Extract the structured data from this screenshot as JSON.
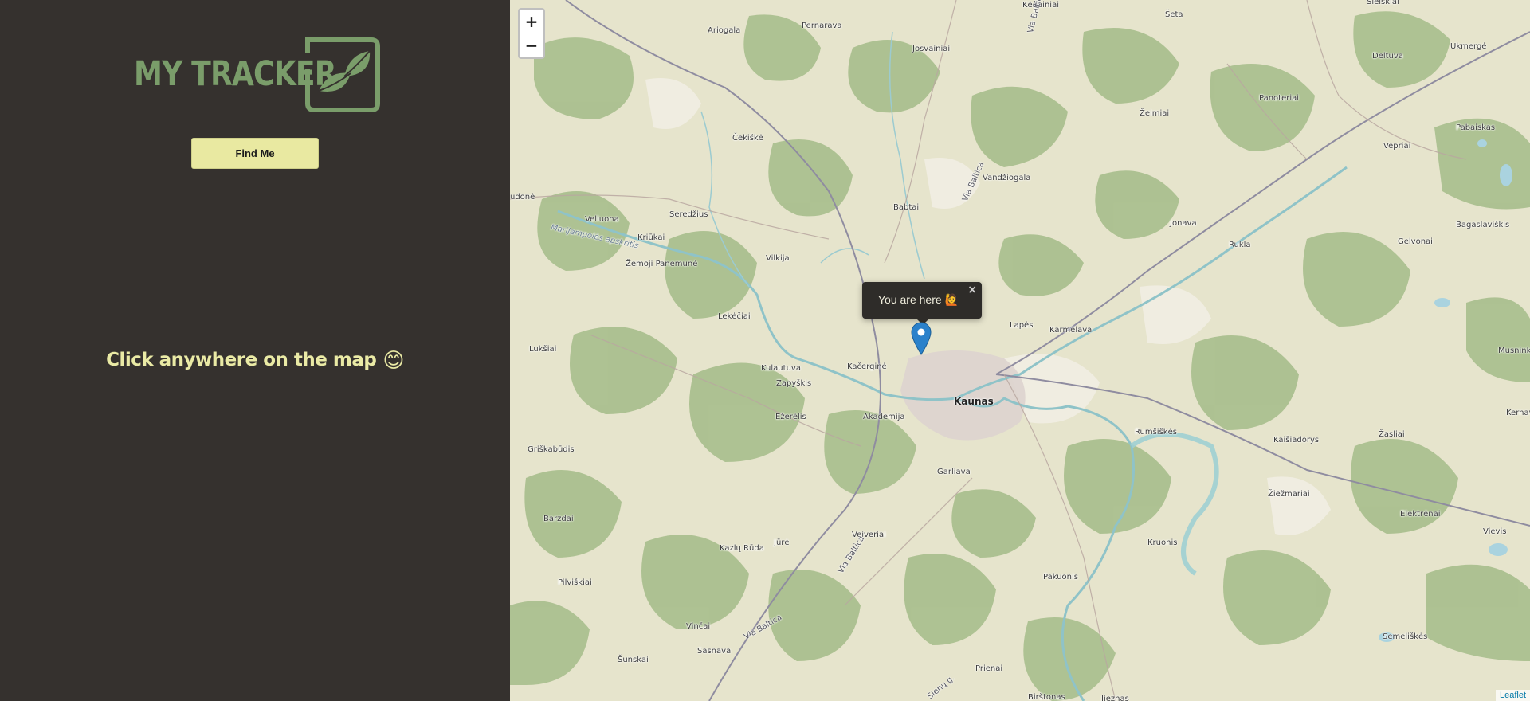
{
  "sidebar": {
    "logo_text": "MY TRACKER",
    "find_button_label": "Find Me",
    "hint_text": "Click anywhere on the map",
    "hint_emoji": "😊"
  },
  "map": {
    "zoom_in": "+",
    "zoom_out": "−",
    "popup_text": "You are here 🙋",
    "popup_close": "×",
    "attribution": "Leaflet",
    "labels": {
      "kedainiai": "Kėdainiai",
      "seta": "Šeta",
      "sleksne": "Sleiškiai",
      "ariogala": "Ariogala",
      "pernarava": "Pernarava",
      "josvainiai": "Josvainiai",
      "ukmerge": "Ukmergė",
      "deltuva": "Deltuva",
      "panoteriai": "Panoteriai",
      "zeimiai": "Žeimiai",
      "pabaiskas": "Pabaiskas",
      "vepriai": "Vepriai",
      "cekiske": "Čekiškė",
      "vandziogala": "Vandžiogala",
      "babtai": "Babtai",
      "budone": "udonė",
      "veliuona": "Veliuona",
      "seredzius": "Seredžius",
      "kriukai": "Kriūkai",
      "marijampoles": "Marijampolės apskritis",
      "jonava": "Jonava",
      "bagaslaviskis": "Bagaslaviškis",
      "gelvonai": "Gelvonai",
      "rukla": "Rukla",
      "zemoji": "Žemoji Panemunė",
      "vilkija": "Vilkija",
      "lekeciai": "Lekėčiai",
      "lapes": "Lapės",
      "karmelava": "Karmėlava",
      "luksiai": "Lukšiai",
      "musninkai": "Musnink",
      "kulautuva": "Kulautuva",
      "kacergine": "Kačerginė",
      "zapyskis": "Zapyškis",
      "kaunas": "Kaunas",
      "kernave": "Kernav",
      "ezerelis": "Ežerėlis",
      "akademija": "Akademija",
      "rumsiskes": "Rumšiškės",
      "kaisiadorys": "Kaišiadorys",
      "zasliai": "Žasliai",
      "griskabudis": "Griškabūdis",
      "garliava": "Garliava",
      "ziezmariai": "Žiežmariai",
      "elektrenai": "Elektrėnai",
      "barzdai": "Barzdai",
      "veiveriai": "Veiveriai",
      "vievis": "Vievis",
      "kazlu_ruda": "Kazlų Rūda",
      "jure": "Jūrė",
      "kruonis": "Kruonis",
      "pilviskiai": "Pilviškiai",
      "pakuonis": "Pakuonis",
      "vinciai": "Vinčai",
      "semeliskes": "Semeliškės",
      "sasnava": "Sasnava",
      "sunskai": "Šunskai",
      "prienai": "Prienai",
      "birstonas": "Birštonas",
      "jieznas": "Jieznas",
      "via_baltica_n": "Via Baltica",
      "via_baltica_mid": "Via Baltica",
      "via_baltica_s": "Via Baltica",
      "via_baltica_sw": "Via Baltica",
      "kelias_s": "Sienų g."
    }
  },
  "colors": {
    "sidebar_bg": "#35312e",
    "button_bg": "#e9e9a1",
    "hint_color": "#eaeaa5",
    "logo_green": "#7a9d6a",
    "marker_blue": "#2a81cb"
  }
}
